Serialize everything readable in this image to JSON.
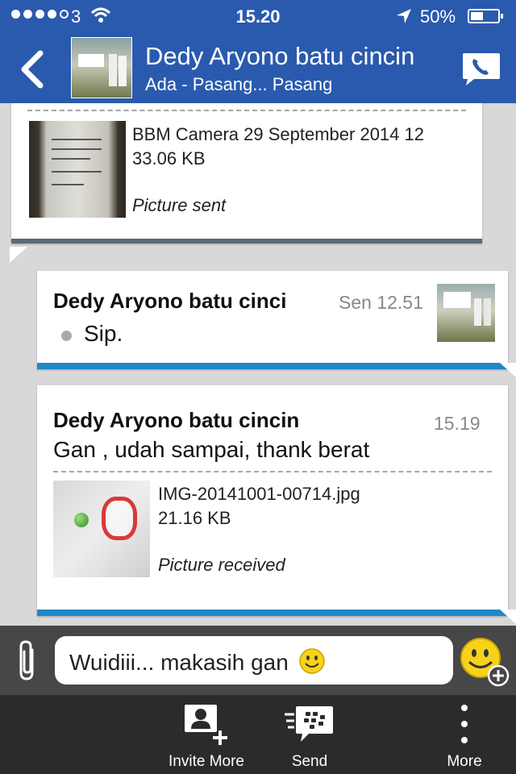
{
  "status_bar": {
    "carrier": "3",
    "time": "15.20",
    "battery": "50%",
    "battery_level": 0.5,
    "signal_bars_filled": 4,
    "signal_bars_total": 5
  },
  "header": {
    "contact_name": "Dedy Aryono batu cincin",
    "contact_status": "Ada - Pasang... Pasang",
    "back_icon": "chevron-left-icon",
    "call_icon": "phone-icon"
  },
  "messages": [
    {
      "direction": "sent",
      "attachment": {
        "name": "BBM Camera 29 September 2014 12",
        "size": "33.06 KB",
        "status": "Picture sent"
      }
    },
    {
      "direction": "received",
      "sender": "Dedy Aryono batu cinci",
      "time": "Sen 12.51",
      "text": "Sip."
    },
    {
      "direction": "received",
      "sender": "Dedy Aryono batu cincin",
      "time": "15.19",
      "text": "Gan , udah sampai, thank berat",
      "attachment": {
        "name": "IMG-20141001-00714.jpg",
        "size": "21.16 KB",
        "status": "Picture received"
      }
    }
  ],
  "compose": {
    "value": "Wuidiii... makasih gan",
    "attach_icon": "paperclip-icon",
    "emoji_icon": "smiley-add-icon"
  },
  "toolbar": {
    "items": [
      {
        "label": "Invite More",
        "icon": "invite-contact-icon"
      },
      {
        "label": "Send",
        "icon": "bbm-send-icon"
      },
      {
        "label": "More",
        "icon": "more-vertical-icon"
      }
    ]
  },
  "colors": {
    "header_bg": "#2a5aae",
    "received_accent": "#1e88c8",
    "sent_accent": "#5a6a79",
    "chat_bg": "#d8d8d8",
    "compose_bg": "#474747",
    "toolbar_bg": "#2b2b2b"
  }
}
